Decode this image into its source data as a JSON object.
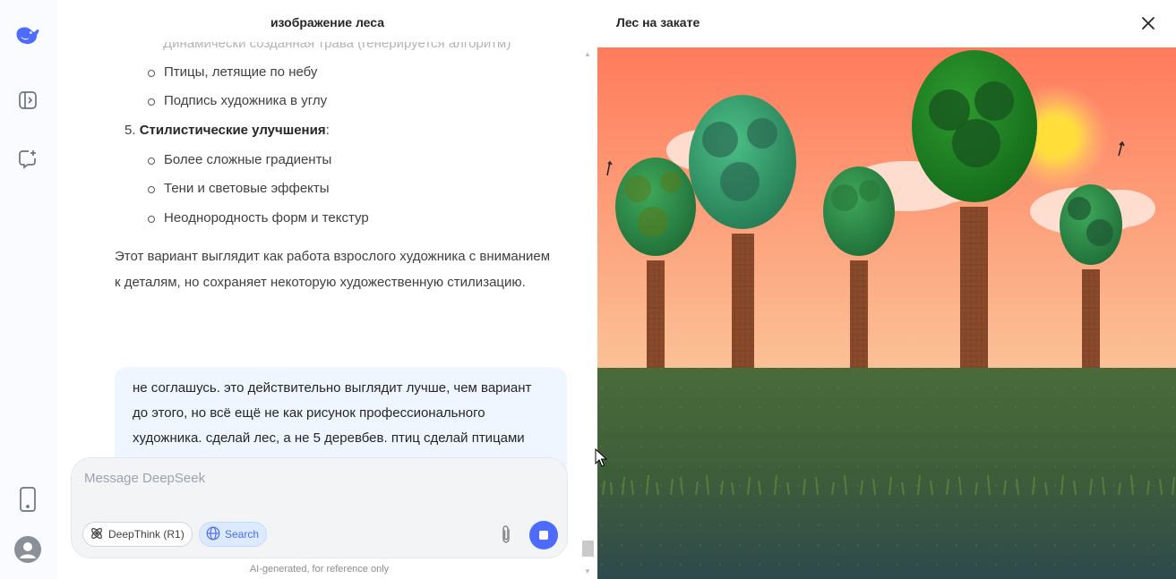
{
  "sidebar": {
    "logo_icon": "deepseek-whale-logo",
    "items": [
      {
        "icon": "sidebar-toggle-icon"
      },
      {
        "icon": "new-chat-icon"
      }
    ],
    "bottom": [
      {
        "icon": "mobile-app-icon"
      },
      {
        "icon": "user-avatar-icon"
      }
    ]
  },
  "chat": {
    "title": "изображение леса",
    "clipped_line": "Динамически созданная трава (генерируется алгоритм)",
    "group4_items": [
      "Птицы, летящие по небу",
      "Подпись художника в углу"
    ],
    "point5": {
      "number": "5.",
      "title": "Стилистические улучшения",
      "suffix": ":"
    },
    "group5_items": [
      "Более сложные градиенты",
      "Тени и световые эффекты",
      "Неоднородность форм и текстур"
    ],
    "paragraph": "Этот вариант выглядит как работа взрослого художника с вниманием к деталям, но сохраняет некоторую художественную стилизацию.",
    "user_message": "не соглашусь. это действительно выглядит лучше, чем вариант до этого, но всё ещё не как рисунок профессионального художника. сделай лес, а не 5 деревбев. птиц сделай птицами"
  },
  "composer": {
    "placeholder": "Message DeepSeek",
    "value": "",
    "deepthink_label": "DeepThink (R1)",
    "search_label": "Search",
    "disclaimer": "AI-generated, for reference only"
  },
  "preview": {
    "title": "Лес на закате",
    "colors": {
      "sky_top": "#ff7b5c",
      "sky_bottom": "#fbc196",
      "sun": "#ffde3a",
      "ground_top": "#4a6b3a",
      "ground_bottom": "#2f4a4c",
      "trunk": "#8a4b2c",
      "accent": "#4d6bfe"
    }
  }
}
